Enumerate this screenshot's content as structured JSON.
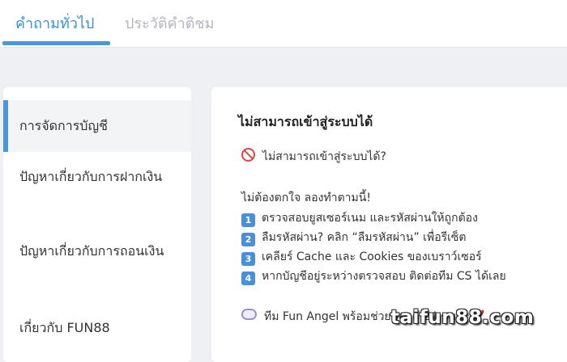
{
  "tabs": [
    {
      "label": "คำถามทั่วไป",
      "active": true
    },
    {
      "label": "ประวัติคำติชม",
      "active": false
    }
  ],
  "colors": {
    "accent": "#4b95db",
    "inactive_tab": "#b3b7bd"
  },
  "sidebar": {
    "items": [
      {
        "label": "การจัดการบัญชี",
        "active": true
      },
      {
        "label": "ปัญหาเกี่ยวกับการฝากเงิน"
      },
      {
        "label": "ปัญหาเกี่ยวกับการถอนเงิน"
      },
      {
        "label": "เกี่ยวกับ FUN88"
      }
    ]
  },
  "article": {
    "title": "ไม่สามารถเข้าสู่ระบบได้",
    "question": "ไม่สามารถเข้าสู่ระบบได้?",
    "intro": "ไม่ต้องตกใจ ลองทำตามนี้!",
    "steps": [
      {
        "num": "1",
        "text": "ตรวจสอบยูสเซอร์เนม และรหัสผ่านให้ถูกต้อง"
      },
      {
        "num": "2",
        "text": "ลืมรหัสผ่าน? คลิก “ลืมรหัสผ่าน” เพื่อรีเซ็ต"
      },
      {
        "num": "3",
        "text": "เคลียร์ Cache และ Cookies ของเบราว์เซอร์"
      },
      {
        "num": "4",
        "text": "หากบัญชีอยู่ระหว่างตรวจสอบ ติดต่อทีม CS ได้เลย"
      }
    ],
    "footer": "ทีม Fun Angel พร้อมช่วยตลอด 24 ชม.!",
    "icons": {
      "question": "prohibited-icon",
      "footer": "speech-bubble-icon",
      "footer_end": "rocket-icon"
    }
  },
  "watermark": "taifun88.com"
}
